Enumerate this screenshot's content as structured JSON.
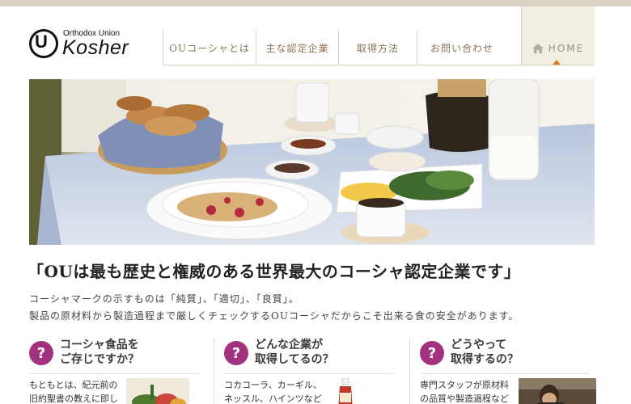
{
  "logo": {
    "symbol": "U",
    "small": "Orthodox Union",
    "big": "Kosher"
  },
  "nav": {
    "items": [
      "OUコーシャとは",
      "主な認定企業",
      "取得方法",
      "お問い合わせ"
    ],
    "home": "HOME",
    "active_color": "#d97a1e"
  },
  "headline": "「OUは最も歴史と権威のある世界最大のコーシャ認定企業です」",
  "intro": {
    "line1": "コーシャマークの示すものは「純質」、「適切」、「良質」。",
    "line2": "製品の原材料から製造過程まで厳しくチェックするOUコーシャだからこそ出来る食の安全があります。"
  },
  "columns": [
    {
      "badge": "?",
      "title1": "コーシャ食品を",
      "title2": "ご存じですか？",
      "text1": "もともとは、紀元前の",
      "text2": "旧約聖書の教えに即し"
    },
    {
      "badge": "?",
      "title1": "どんな企業が",
      "title2": "取得してるの？",
      "text1": "コカコーラ、カーギル、",
      "text2": "ネッスル、ハインツなど"
    },
    {
      "badge": "?",
      "title1": "どうやって",
      "title2": "取得するの？",
      "text1": "専門スタッフが原材料",
      "text2": "の品質や製造過程など"
    }
  ],
  "colors": {
    "badge": "#a2327f",
    "nav_text": "#8a7250",
    "topbar": "#d8d3c0"
  }
}
